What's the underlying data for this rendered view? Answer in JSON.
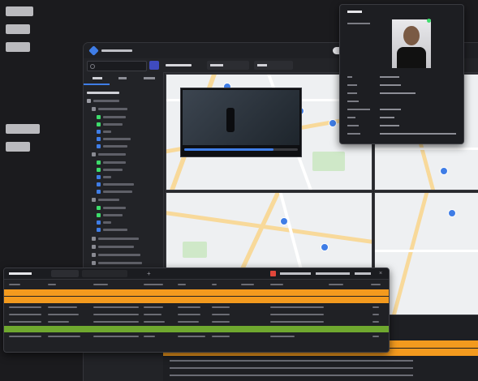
{
  "left_captions": {
    "line1": "",
    "line2": "",
    "line3": "",
    "line4": "",
    "line5": ""
  },
  "window": {
    "title": "",
    "search_placeholder": "",
    "sidebar_tabs": [
      "",
      "",
      ""
    ],
    "tree_root": "",
    "view_tabs": [
      "",
      ""
    ]
  },
  "event_panel": {
    "title": "",
    "tabs": [
      "",
      ""
    ],
    "actions": [
      "",
      "",
      ""
    ],
    "columns": [
      "",
      "",
      "",
      "",
      "",
      "",
      "",
      "",
      ""
    ],
    "rows": [
      {
        "highlight": "orange"
      },
      {
        "highlight": "orange"
      },
      {
        "highlight": "none"
      },
      {
        "highlight": "none"
      },
      {
        "highlight": "none"
      },
      {
        "highlight": "green"
      },
      {
        "highlight": "none"
      }
    ]
  },
  "user_popup": {
    "title": "",
    "photo_label": "",
    "fields": [
      {
        "key": "",
        "value": ""
      },
      {
        "key": "",
        "value": ""
      },
      {
        "key": "",
        "value": ""
      },
      {
        "key": "",
        "value": ""
      },
      {
        "key": "",
        "value": ""
      },
      {
        "key": "",
        "value": ""
      },
      {
        "key": "",
        "value": ""
      },
      {
        "key": "",
        "value": ""
      }
    ]
  },
  "colors": {
    "accent": "#3f7de6",
    "highlight_orange": "#f39a1e",
    "highlight_green": "#6fa82f",
    "status_online": "#3ddc6b"
  }
}
